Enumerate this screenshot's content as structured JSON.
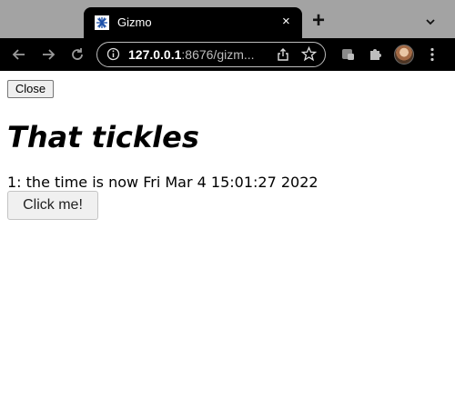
{
  "browser": {
    "tab": {
      "title": "Gizmo",
      "close_glyph": "×"
    },
    "new_tab_glyph": "+",
    "url": {
      "host": "127.0.0.1",
      "rest": ":8676/gizm..."
    },
    "icons": {
      "favicon": "gizmo-favicon",
      "back": "back-arrow-icon",
      "forward": "forward-arrow-icon",
      "reload": "reload-icon",
      "site_info": "info-icon",
      "share": "share-icon",
      "bookmark": "star-icon",
      "extension_1": "extension-icon",
      "extensions": "puzzle-icon",
      "menu": "kebab-menu-icon"
    }
  },
  "page": {
    "close_button": "Close",
    "heading": "That tickles",
    "message": "1: the time is now Fri Mar 4 15:01:27 2022",
    "click_button": "Click me!"
  }
}
